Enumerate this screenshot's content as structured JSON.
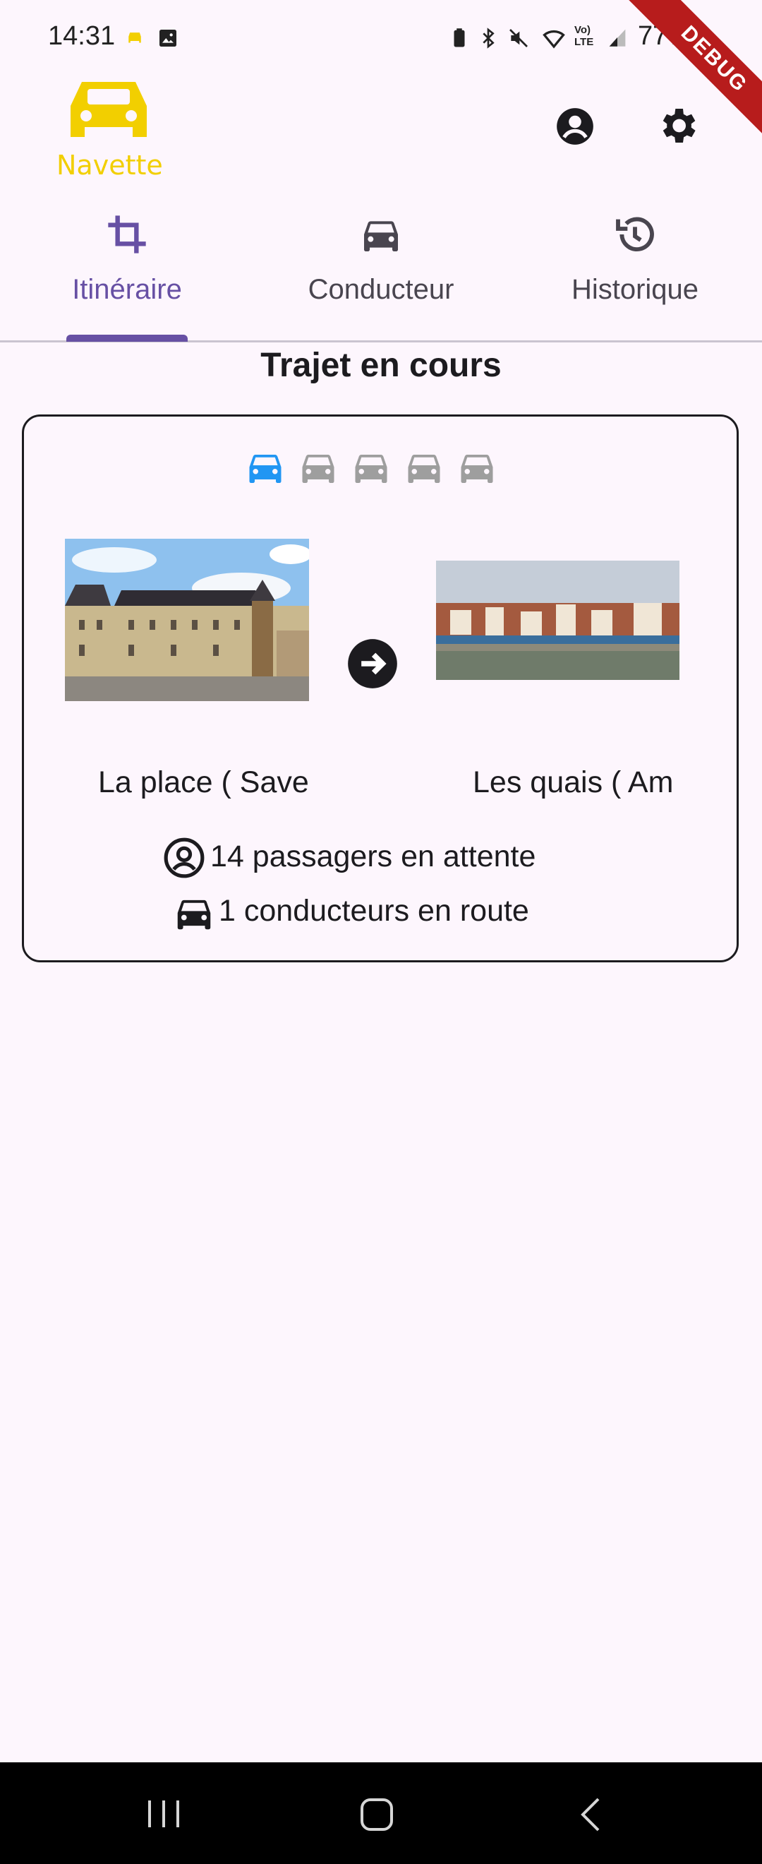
{
  "status_bar": {
    "time": "14:31",
    "battery": "77%"
  },
  "debug_banner": "DEBUG",
  "app": {
    "name": "Navette",
    "logo_color": "#f2cf00"
  },
  "header_icons": [
    "account-circle-icon",
    "settings-gear-icon"
  ],
  "tabs": [
    {
      "label": "Itinéraire",
      "icon": "crop-icon",
      "active": true
    },
    {
      "label": "Conducteur",
      "icon": "car-icon",
      "active": false
    },
    {
      "label": "Historique",
      "icon": "history-icon",
      "active": false
    }
  ],
  "main": {
    "title": "Trajet en cours",
    "progress": {
      "total_steps": 5,
      "current_step": 1,
      "active_color": "#2196f3",
      "inactive_color": "#9e9e9e"
    },
    "origin": {
      "label": "La place ( Save",
      "image": "town-square-photo"
    },
    "destination": {
      "label": "Les quais ( Am",
      "image": "riverside-quays-photo"
    },
    "passengers_text": "14 passagers en attente",
    "drivers_text": "1 conducteurs en route"
  },
  "colors": {
    "accent": "#6750a4",
    "background": "#fdf6fd"
  }
}
